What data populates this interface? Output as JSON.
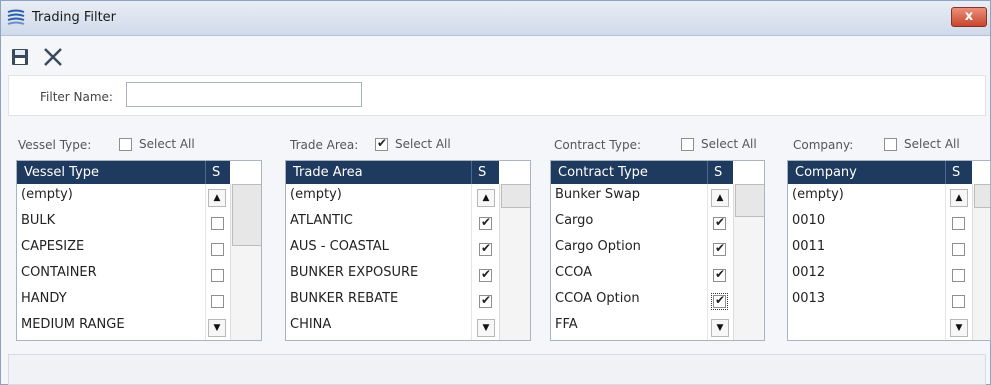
{
  "window": {
    "title": "Trading Filter",
    "close_label": "x"
  },
  "toolbar": {
    "save_icon": "save-icon",
    "cancel_icon": "close-icon"
  },
  "filter_name": {
    "label": "Filter Name:",
    "value": ""
  },
  "grids": [
    {
      "section_label": "Vessel Type:",
      "select_all": {
        "label": "Select All",
        "checked": false
      },
      "column_header": "Vessel Type",
      "s_header": "S",
      "rows": [
        {
          "label": "(empty)",
          "checked": false
        },
        {
          "label": "BULK",
          "checked": false
        },
        {
          "label": "CAPESIZE",
          "checked": false
        },
        {
          "label": "CONTAINER",
          "checked": false
        },
        {
          "label": "HANDY",
          "checked": false
        },
        {
          "label": "MEDIUM RANGE",
          "checked": false
        }
      ]
    },
    {
      "section_label": "Trade Area:",
      "select_all": {
        "label": "Select All",
        "checked": true
      },
      "column_header": "Trade Area",
      "s_header": "S",
      "rows": [
        {
          "label": "(empty)",
          "checked": true
        },
        {
          "label": "ATLANTIC",
          "checked": true
        },
        {
          "label": "AUS - COASTAL",
          "checked": true
        },
        {
          "label": "BUNKER EXPOSURE",
          "checked": true
        },
        {
          "label": "BUNKER REBATE",
          "checked": true
        },
        {
          "label": "CHINA",
          "checked": true
        }
      ]
    },
    {
      "section_label": "Contract Type:",
      "select_all": {
        "label": "Select All",
        "checked": false
      },
      "column_header": "Contract Type",
      "s_header": "S",
      "rows": [
        {
          "label": "Bunker Swap",
          "checked": false
        },
        {
          "label": "Cargo",
          "checked": true
        },
        {
          "label": "Cargo Option",
          "checked": true
        },
        {
          "label": "CCOA",
          "checked": true
        },
        {
          "label": "CCOA Option",
          "checked": true
        },
        {
          "label": "FFA",
          "checked": false
        }
      ]
    },
    {
      "section_label": "Company:",
      "select_all": {
        "label": "Select All",
        "checked": false
      },
      "column_header": "Company",
      "s_header": "S",
      "rows": [
        {
          "label": "(empty)",
          "checked": false
        },
        {
          "label": "0010",
          "checked": false
        },
        {
          "label": "0011",
          "checked": false
        },
        {
          "label": "0012",
          "checked": false
        },
        {
          "label": "0013",
          "checked": false
        },
        {
          "label": "",
          "checked": false
        }
      ]
    }
  ],
  "colors": {
    "header_bg": "#1f3a5f",
    "close_button": "#c9452d"
  }
}
